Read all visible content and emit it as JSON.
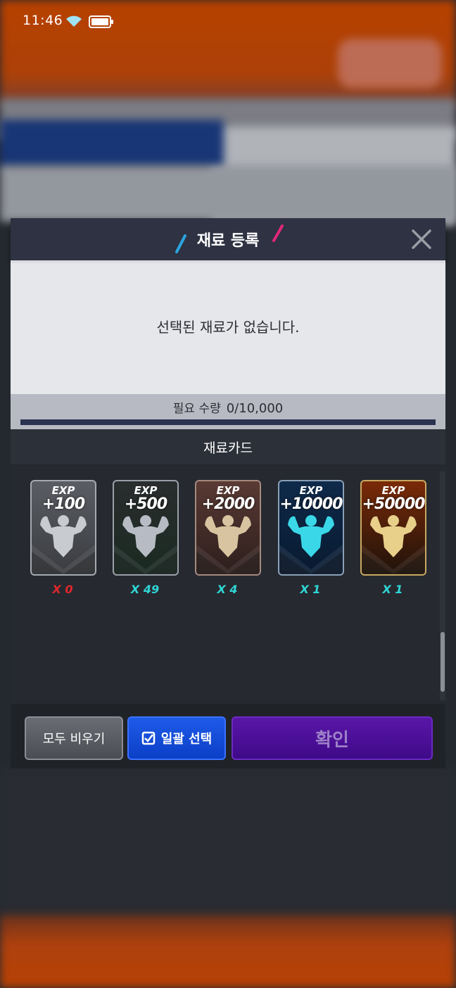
{
  "status_bar": {
    "time": "11:46"
  },
  "modal": {
    "title": "재료 등록",
    "empty_message": "선택된 재료가 없습니다.",
    "required_label": "필요 수량",
    "required_value": "0/10,000",
    "required_progress": 0,
    "cards_section_title": "재료카드"
  },
  "cards": [
    {
      "exp_label": "EXP",
      "amount": "+100",
      "count": "X 0",
      "tier": "silver"
    },
    {
      "exp_label": "EXP",
      "amount": "+500",
      "count": "X 49",
      "tier": "dark-green"
    },
    {
      "exp_label": "EXP",
      "amount": "+2000",
      "count": "X 4",
      "tier": "bronze"
    },
    {
      "exp_label": "EXP",
      "amount": "+10000",
      "count": "X 1",
      "tier": "cyan"
    },
    {
      "exp_label": "EXP",
      "amount": "+50000",
      "count": "X 1",
      "tier": "gold"
    }
  ],
  "buttons": {
    "clear_all": "모두 비우기",
    "bulk_select": "일괄 선택",
    "confirm": "확인"
  },
  "colors": {
    "count_zero": "#e0262c",
    "count_positive": "#2fd6d6",
    "slash_left": "#2aa6e0",
    "slash_right": "#e0287a"
  }
}
